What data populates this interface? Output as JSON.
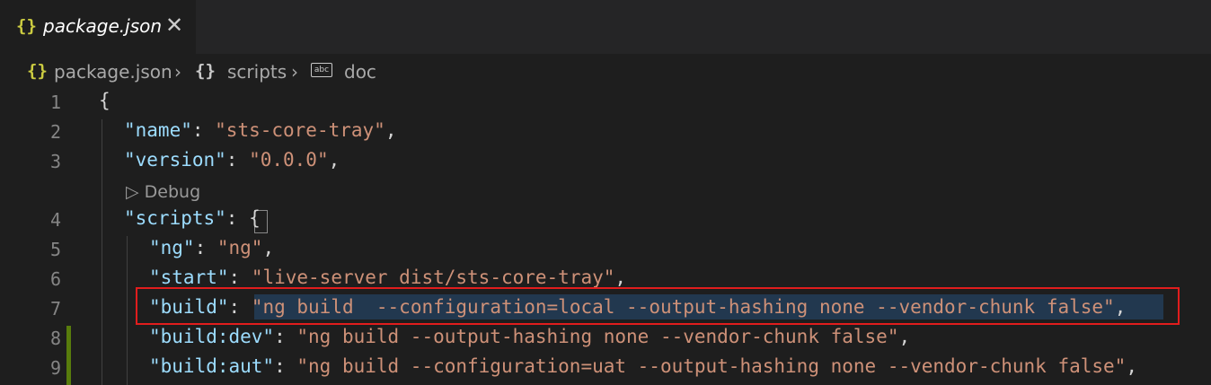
{
  "tab": {
    "icon": "{}",
    "title": "package.json",
    "close": "✕"
  },
  "breadcrumb": {
    "file_icon": "{}",
    "file": "package.json",
    "sep1": "›",
    "obj_icon": "{}",
    "section": "scripts",
    "sep2": "›",
    "string_icon_text": "abc",
    "item": "doc"
  },
  "codelens": {
    "label": "▷ Debug"
  },
  "lines": [
    {
      "n": "1",
      "open": "{"
    },
    {
      "n": "2",
      "key": "\"name\"",
      "colon": ": ",
      "value": "\"sts-core-tray\"",
      "end": ","
    },
    {
      "n": "3",
      "key": "\"version\"",
      "colon": ": ",
      "value": "\"0.0.0\"",
      "end": ","
    },
    {
      "n": "4",
      "key": "\"scripts\"",
      "colon": ": ",
      "brace": "{"
    },
    {
      "n": "5",
      "key": "\"ng\"",
      "colon": ": ",
      "value": "\"ng\"",
      "end": ","
    },
    {
      "n": "6",
      "key": "\"start\"",
      "colon": ": ",
      "value": "\"live-server dist/sts-core-tray\"",
      "end": ","
    },
    {
      "n": "7",
      "key": "\"build\"",
      "colon": ": ",
      "value": "\"ng build  --configuration=local --output-hashing none --vendor-chunk false\"",
      "end": ","
    },
    {
      "n": "8",
      "key": "\"build:dev\"",
      "colon": ": ",
      "value": "\"ng build --output-hashing none --vendor-chunk false\"",
      "end": ","
    },
    {
      "n": "9",
      "key": "\"build:aut\"",
      "colon": ": ",
      "value": "\"ng build --configuration=uat --output-hashing none --vendor-chunk false\"",
      "end": ","
    }
  ],
  "colors": {
    "highlight_box": "#e11d1d",
    "modified_gutter": "#587c0c",
    "key": "#9cdcfe",
    "string": "#ce9178"
  }
}
